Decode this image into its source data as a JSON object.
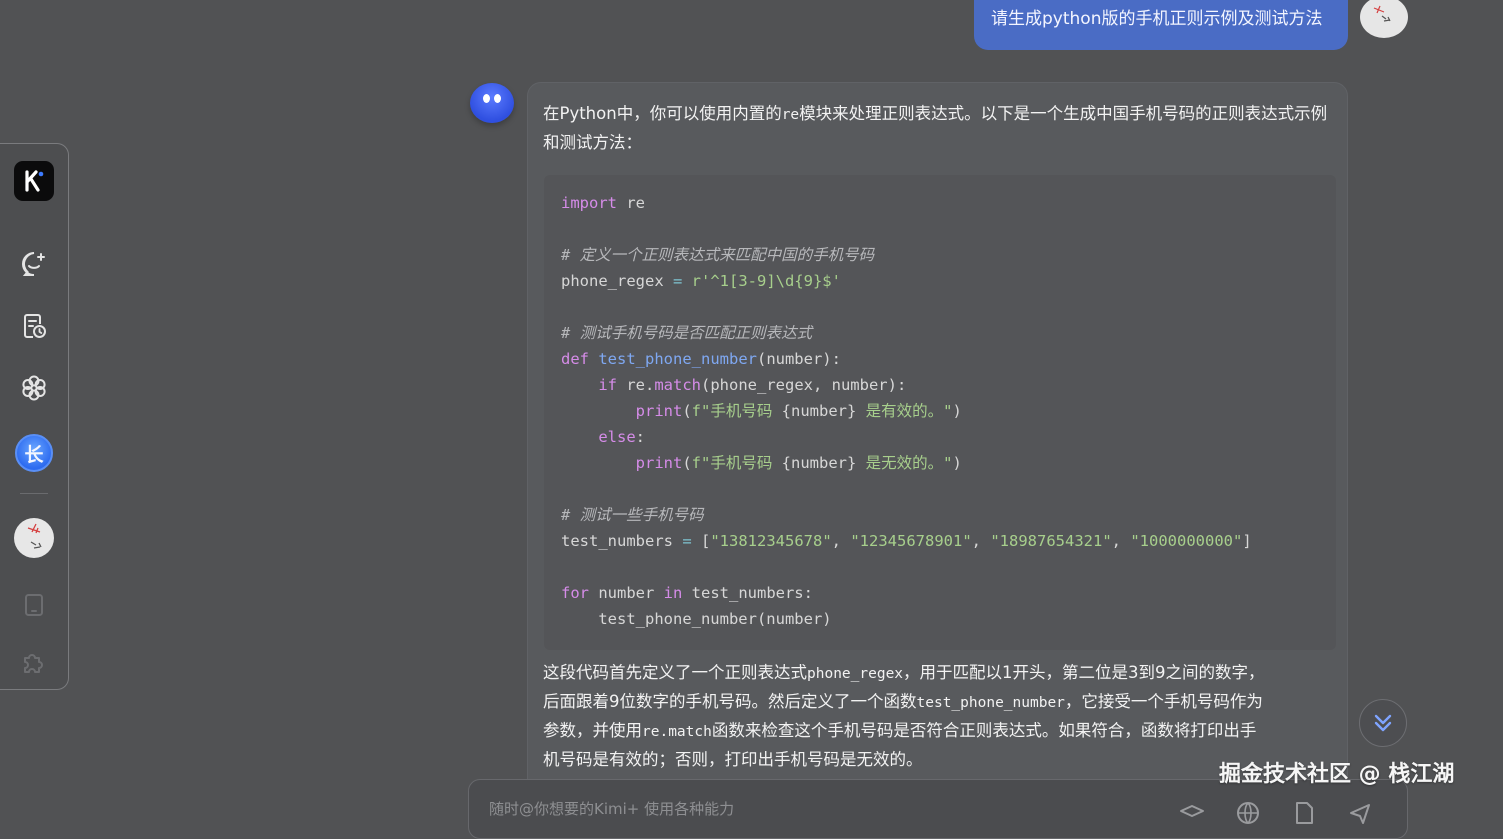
{
  "user_message": {
    "text": "请生成python版的手机正则示例及测试方法"
  },
  "sidebar": {
    "logo_letter": "K",
    "avatar_blue_letter": "长"
  },
  "answer": {
    "intro": {
      "part1": "在Python中，你可以使用内置的",
      "code": "re",
      "part2": "模块来处理正则表达式。以下是一个生成中国手机号码的正则表达式示例和测试方法："
    },
    "code_lines": [
      [
        {
          "t": "import",
          "c": "kw"
        },
        {
          "t": " re",
          "c": ""
        }
      ],
      [],
      [
        {
          "t": "# 定义一个正则表达式来匹配中国的手机号码",
          "c": "cm"
        }
      ],
      [
        {
          "t": "phone_regex ",
          "c": ""
        },
        {
          "t": "=",
          "c": "op"
        },
        {
          "t": " r'^1[3-9]\\d{9}$'",
          "c": "str"
        }
      ],
      [],
      [
        {
          "t": "# 测试手机号码是否匹配正则表达式",
          "c": "cm"
        }
      ],
      [
        {
          "t": "def",
          "c": "kw"
        },
        {
          "t": " ",
          "c": ""
        },
        {
          "t": "test_phone_number",
          "c": "fn"
        },
        {
          "t": "(number):",
          "c": ""
        }
      ],
      [
        {
          "t": "    ",
          "c": ""
        },
        {
          "t": "if",
          "c": "kw"
        },
        {
          "t": " re.",
          "c": ""
        },
        {
          "t": "match",
          "c": "kw"
        },
        {
          "t": "(phone_regex, number):",
          "c": ""
        }
      ],
      [
        {
          "t": "        ",
          "c": ""
        },
        {
          "t": "print",
          "c": "kw"
        },
        {
          "t": "(",
          "c": ""
        },
        {
          "t": "f\"手机号码 ",
          "c": "str"
        },
        {
          "t": "{number}",
          "c": ""
        },
        {
          "t": " 是有效的。\"",
          "c": "str"
        },
        {
          "t": ")",
          "c": ""
        }
      ],
      [
        {
          "t": "    ",
          "c": ""
        },
        {
          "t": "else",
          "c": "kw"
        },
        {
          "t": ":",
          "c": ""
        }
      ],
      [
        {
          "t": "        ",
          "c": ""
        },
        {
          "t": "print",
          "c": "kw"
        },
        {
          "t": "(",
          "c": ""
        },
        {
          "t": "f\"手机号码 ",
          "c": "str"
        },
        {
          "t": "{number}",
          "c": ""
        },
        {
          "t": " 是无效的。\"",
          "c": "str"
        },
        {
          "t": ")",
          "c": ""
        }
      ],
      [],
      [
        {
          "t": "# 测试一些手机号码",
          "c": "cm"
        }
      ],
      [
        {
          "t": "test_numbers ",
          "c": ""
        },
        {
          "t": "=",
          "c": "op"
        },
        {
          "t": " [",
          "c": ""
        },
        {
          "t": "\"13812345678\"",
          "c": "str"
        },
        {
          "t": ", ",
          "c": ""
        },
        {
          "t": "\"12345678901\"",
          "c": "str"
        },
        {
          "t": ", ",
          "c": ""
        },
        {
          "t": "\"18987654321\"",
          "c": "str"
        },
        {
          "t": ", ",
          "c": ""
        },
        {
          "t": "\"1000000000\"",
          "c": "str"
        },
        {
          "t": "]",
          "c": ""
        }
      ],
      [],
      [
        {
          "t": "for",
          "c": "kw"
        },
        {
          "t": " number ",
          "c": ""
        },
        {
          "t": "in",
          "c": "kw"
        },
        {
          "t": " test_numbers:",
          "c": ""
        }
      ],
      [
        {
          "t": "    test_phone_number(number)",
          "c": ""
        }
      ]
    ],
    "explain": {
      "line1a": "这段代码首先定义了一个正则表达式",
      "line1code": "phone_regex",
      "line1b": "，用于匹配以1开头，第二位是3到9之间的数字，",
      "line2a": "后面跟着9位数字的手机号码。然后定义了一个函数",
      "line2code": "test_phone_number",
      "line2b": "，它接受一个手机号码作为",
      "line3a": "参数，并使用",
      "line3code": "re.match",
      "line3b": "函数来检查这个手机号码是否符合正则表达式。如果符合，函数将打印出手",
      "line4": "机号码是有效的；否则，打印出手机号码是无效的。"
    }
  },
  "input": {
    "placeholder": "随时@你想要的Kimi+ 使用各种能力"
  },
  "watermark": "掘金技术社区 @ 栈江湖"
}
